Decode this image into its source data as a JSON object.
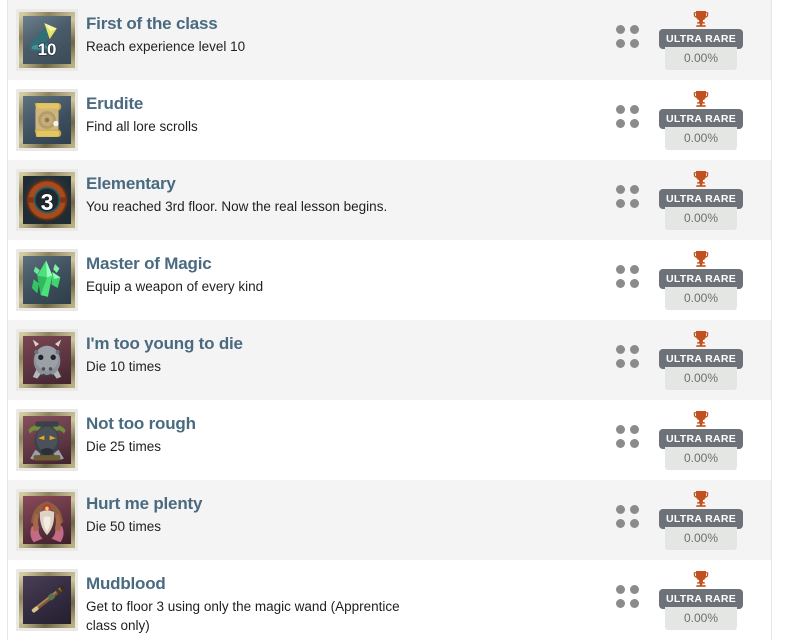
{
  "page": {
    "type": "achievement-list",
    "accent_title_color": "#4a6a80",
    "trophy_color": "#c4501f",
    "badge_bg_color": "#6c7278",
    "row_alt_bg": "#f4f4f4"
  },
  "achievements": [
    {
      "title": "First of the class",
      "description": "Reach experience level 10",
      "icon": "axe-level-10-icon",
      "rarity_label": "ULTRA RARE",
      "percent": "0.00%",
      "trophy": "trophy-icon",
      "dots": "four-dots-icon"
    },
    {
      "title": "Erudite",
      "description": "Find all lore scrolls",
      "icon": "lore-scroll-icon",
      "rarity_label": "ULTRA RARE",
      "percent": "0.00%",
      "trophy": "trophy-icon",
      "dots": "four-dots-icon"
    },
    {
      "title": "Elementary",
      "description": "You reached 3rd floor. Now the real lesson begins.",
      "icon": "floor-three-door-icon",
      "rarity_label": "ULTRA RARE",
      "percent": "0.00%",
      "trophy": "trophy-icon",
      "dots": "four-dots-icon"
    },
    {
      "title": "Master of Magic",
      "description": "Equip a weapon of every kind",
      "icon": "green-crystal-icon",
      "rarity_label": "ULTRA RARE",
      "percent": "0.00%",
      "trophy": "trophy-icon",
      "dots": "four-dots-icon"
    },
    {
      "title": "I'm too young to die",
      "description": "Die 10 times",
      "icon": "horned-beast-head-icon",
      "rarity_label": "ULTRA RARE",
      "percent": "0.00%",
      "trophy": "trophy-icon",
      "dots": "four-dots-icon"
    },
    {
      "title": "Not too rough",
      "description": "Die 25 times",
      "icon": "masked-warrior-icon",
      "rarity_label": "ULTRA RARE",
      "percent": "0.00%",
      "trophy": "trophy-icon",
      "dots": "four-dots-icon"
    },
    {
      "title": "Hurt me plenty",
      "description": "Die 50 times",
      "icon": "hooded-figure-icon",
      "rarity_label": "ULTRA RARE",
      "percent": "0.00%",
      "trophy": "trophy-icon",
      "dots": "four-dots-icon"
    },
    {
      "title": "Mudblood",
      "description": "Get to floor 3 using only the magic wand (Apprentice class only)",
      "icon": "magic-wand-icon",
      "rarity_label": "ULTRA RARE",
      "percent": "0.00%",
      "trophy": "trophy-icon",
      "dots": "four-dots-icon"
    }
  ]
}
